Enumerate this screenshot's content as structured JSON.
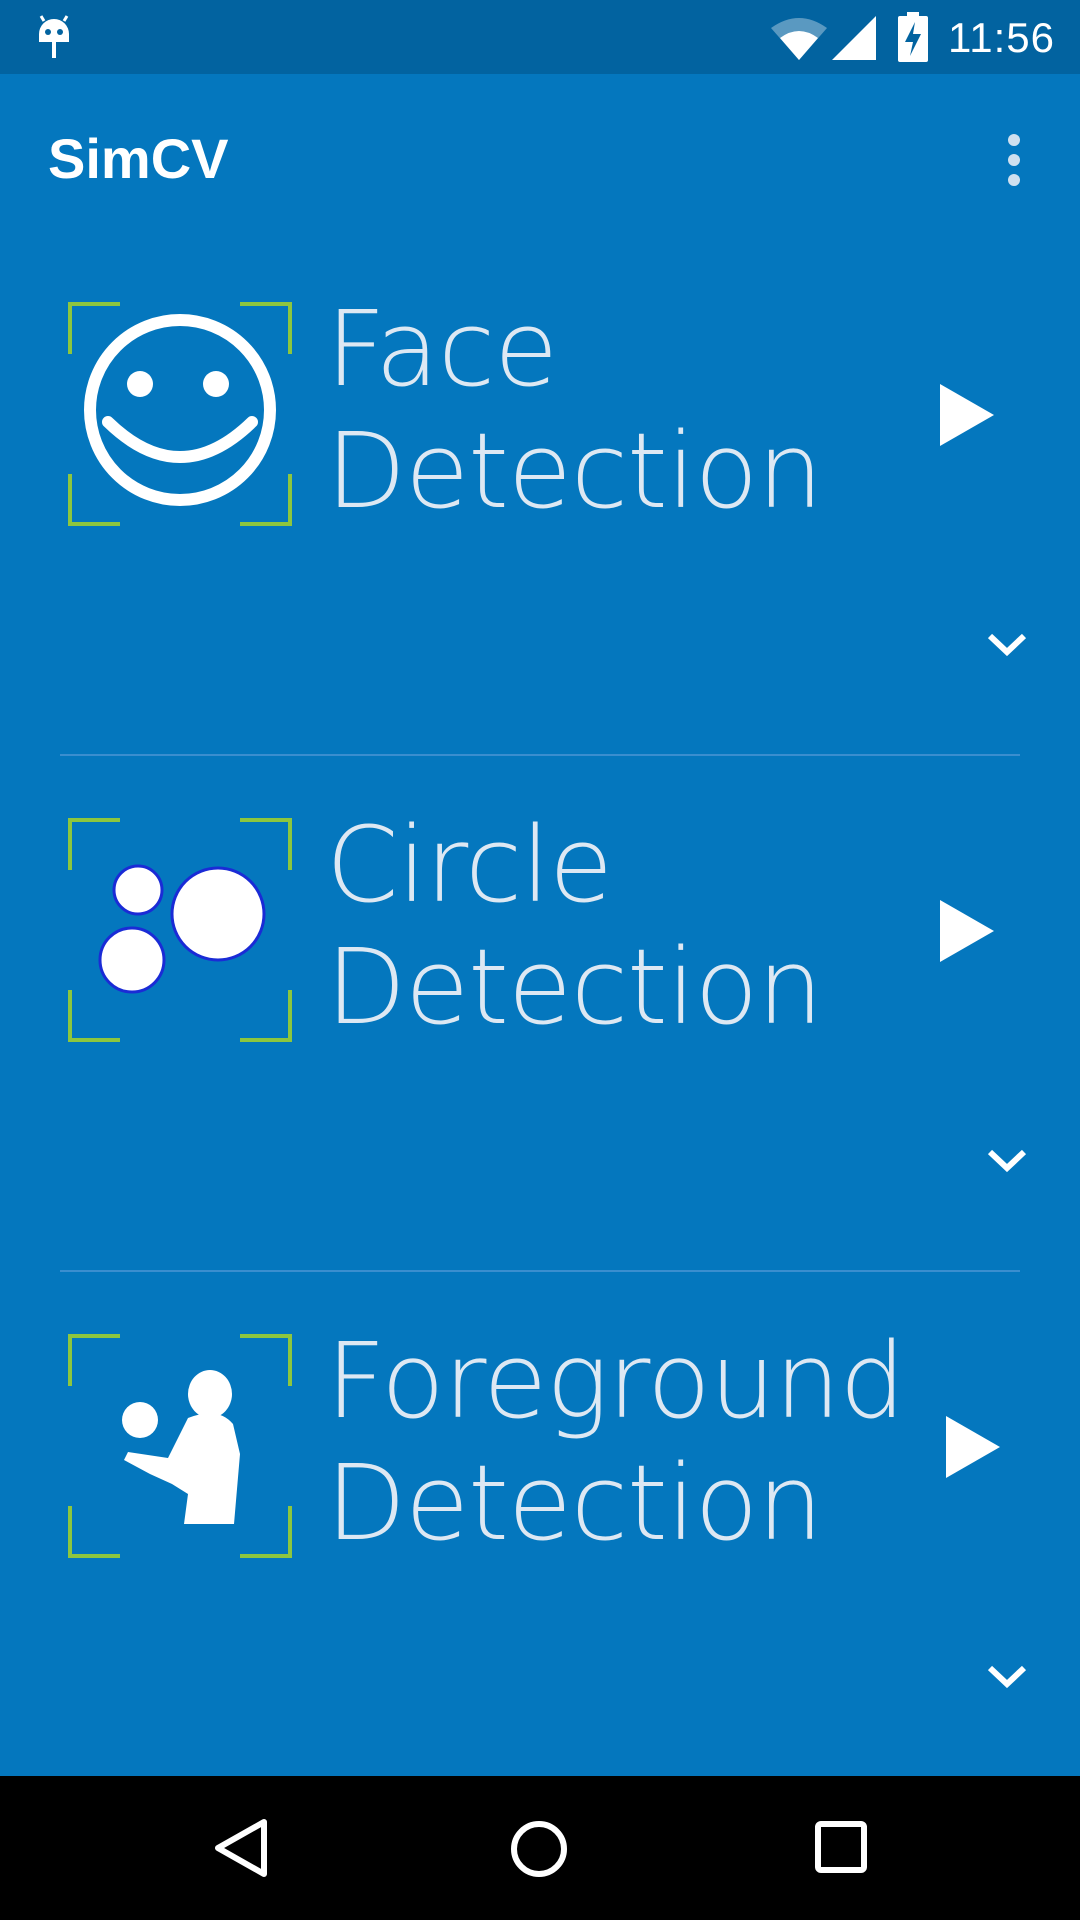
{
  "status_bar": {
    "time": "11:56",
    "icons": [
      "android-icon",
      "wifi-icon",
      "cell-signal-icon",
      "battery-charging-icon"
    ]
  },
  "app_bar": {
    "title": "SimCV",
    "overflow_icon": "more-vert-icon"
  },
  "cards": [
    {
      "title_line1": "Face",
      "title_line2": "Detection",
      "thumb_icon": "smiley-face-icon",
      "action_icon": "play-icon",
      "expand_icon": "chevron-down-icon"
    },
    {
      "title_line1": "Circle",
      "title_line2": "Detection",
      "thumb_icon": "circles-icon",
      "action_icon": "play-icon",
      "expand_icon": "chevron-down-icon"
    },
    {
      "title_line1": "Foreground",
      "title_line2": "Detection",
      "thumb_icon": "person-juggling-icon",
      "action_icon": "play-icon",
      "expand_icon": "chevron-down-icon"
    }
  ],
  "nav_bar": {
    "icons": [
      "back-icon",
      "home-icon",
      "recents-icon"
    ]
  },
  "colors": {
    "background": "#0477BE",
    "status_bar": "#0263A0",
    "frame_corners": "#8DC63F",
    "text": "#dde8f3",
    "nav_bar": "#000000"
  }
}
